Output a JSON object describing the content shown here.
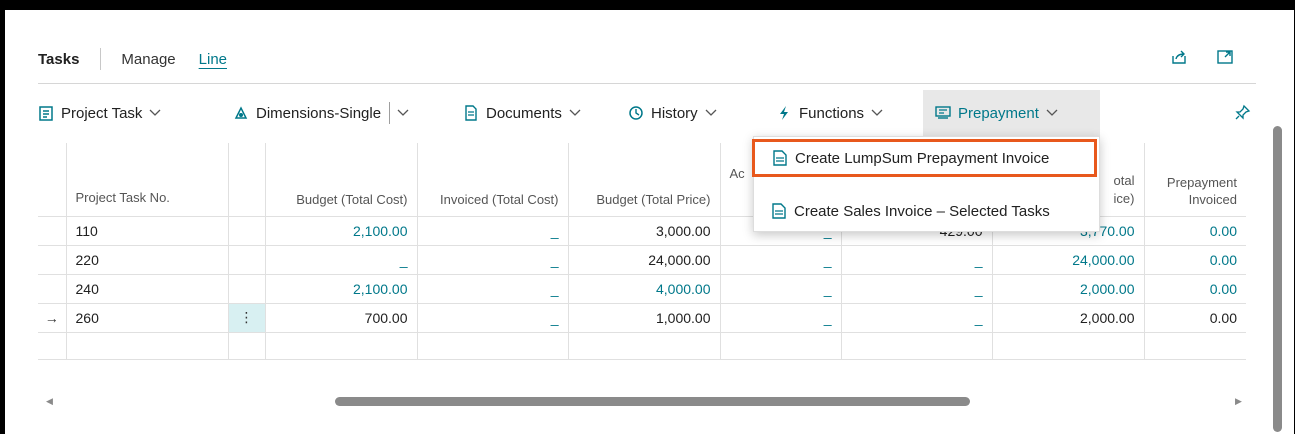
{
  "tabs": {
    "title": "Tasks",
    "items": [
      "Manage",
      "Line"
    ],
    "active": "Line"
  },
  "actions": {
    "project_task": "Project Task",
    "dimensions": "Dimensions-Single",
    "documents": "Documents",
    "history": "History",
    "functions": "Functions",
    "prepayment": "Prepayment"
  },
  "menu": {
    "item1": "Create LumpSum Prepayment Invoice",
    "item2": "Create Sales Invoice – Selected Tasks"
  },
  "columns": {
    "task_no": "Project Task No.",
    "budget_total_cost": "Budget (Total Cost)",
    "invoiced_total_cost": "Invoiced (Total Cost)",
    "budget_total_price": "Budget (Total Price)",
    "col5_partial": "Ac",
    "col7_partial_a": "otal",
    "col7_partial_b": "ice)",
    "prepayment_invoiced": "Prepayment Invoiced"
  },
  "rows": [
    {
      "task": "110",
      "budget_cost": "2,100.00",
      "invoiced_cost": "_",
      "budget_price": "3,000.00",
      "col5": "_",
      "col6": "429.00",
      "col7": "3,770.00",
      "prepay": "0.00",
      "current": false
    },
    {
      "task": "220",
      "budget_cost": "_",
      "invoiced_cost": "_",
      "budget_price": "24,000.00",
      "col5": "_",
      "col6": "_",
      "col7": "24,000.00",
      "prepay": "0.00",
      "current": false
    },
    {
      "task": "240",
      "budget_cost": "2,100.00",
      "invoiced_cost": "_",
      "budget_price": "4,000.00",
      "col5": "_",
      "col6": "_",
      "col7": "2,000.00",
      "prepay": "0.00",
      "current": false
    },
    {
      "task": "260",
      "budget_cost": "700.00",
      "invoiced_cost": "_",
      "budget_price": "1,000.00",
      "col5": "_",
      "col6": "_",
      "col7": "2,000.00",
      "prepay": "0.00",
      "current": true
    }
  ],
  "current_row_marker": "→",
  "row_menu_glyph": "⋮",
  "colors": {
    "accent": "#00788a",
    "highlight": "#e8581c",
    "selected_cell": "#d8f0f2"
  }
}
